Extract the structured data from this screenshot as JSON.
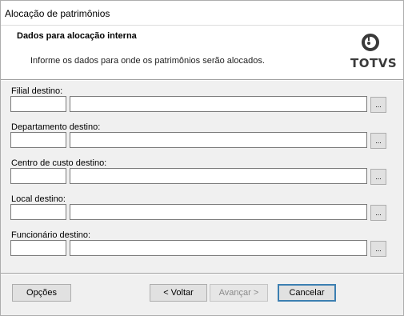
{
  "window": {
    "title": "Alocação de patrimônios"
  },
  "header": {
    "title": "Dados para alocação interna",
    "subtitle": "Informe os dados para onde os patrimônios serão alocados.",
    "logo_text": "TOTVS"
  },
  "fields": [
    {
      "label": "Filial destino:",
      "code": "",
      "description": "",
      "lookup": "..."
    },
    {
      "label": "Departamento destino:",
      "code": "",
      "description": "",
      "lookup": "..."
    },
    {
      "label": "Centro de custo destino:",
      "code": "",
      "description": "",
      "lookup": "..."
    },
    {
      "label": "Local destino:",
      "code": "",
      "description": "",
      "lookup": "..."
    },
    {
      "label": "Funcionário destino:",
      "code": "",
      "description": "",
      "lookup": "..."
    }
  ],
  "footer": {
    "options_label": "Opções",
    "back_label": "< Voltar",
    "next_label": "Avançar >",
    "cancel_label": "Cancelar"
  }
}
